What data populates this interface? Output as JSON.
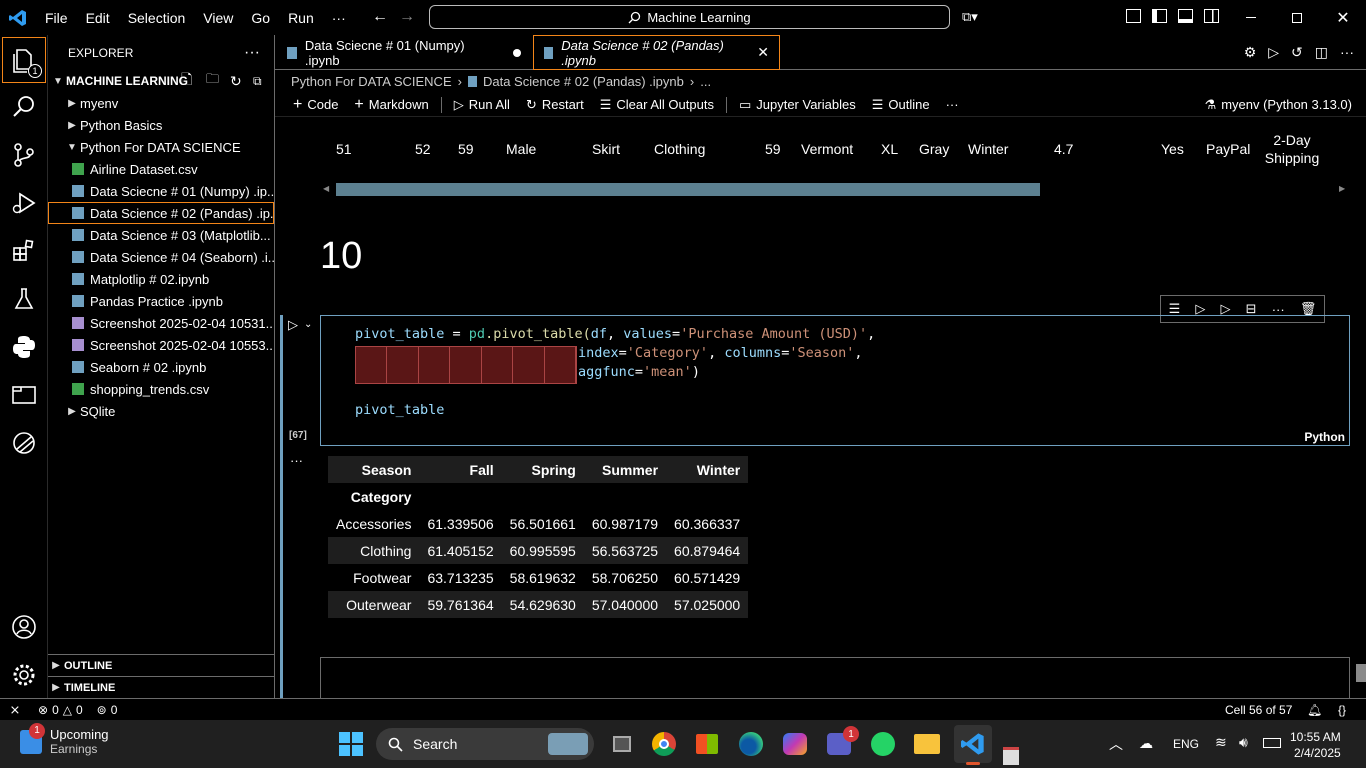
{
  "titlebar": {
    "menu": [
      "File",
      "Edit",
      "Selection",
      "View",
      "Go",
      "Run",
      "···"
    ],
    "search_text": "Machine Learning"
  },
  "activity": {
    "explorer_badge": "1"
  },
  "explorer": {
    "title": "EXPLORER",
    "root": "MACHINE LEARNING",
    "items": [
      {
        "label": "myenv",
        "type": "folder",
        "indent": 1,
        "open": false
      },
      {
        "label": "Python Basics",
        "type": "folder",
        "indent": 1,
        "open": false
      },
      {
        "label": "Python For DATA SCIENCE",
        "type": "folder",
        "indent": 1,
        "open": true
      },
      {
        "label": "Airline Dataset.csv",
        "type": "csv",
        "indent": 2
      },
      {
        "label": "Data Sciecne # 01 (Numpy) .ip...",
        "type": "nb",
        "indent": 2
      },
      {
        "label": "Data Science # 02 (Pandas) .ip...",
        "type": "nb",
        "indent": 2,
        "selected": true
      },
      {
        "label": "Data Science # 03  (Matplotlib...",
        "type": "nb",
        "indent": 2
      },
      {
        "label": "Data Science # 04  (Seaborn) .i...",
        "type": "nb",
        "indent": 2
      },
      {
        "label": "Matplotlip # 02.ipynb",
        "type": "nb",
        "indent": 2
      },
      {
        "label": "Pandas Practice .ipynb",
        "type": "nb",
        "indent": 2
      },
      {
        "label": "Screenshot 2025-02-04 10531...",
        "type": "img",
        "indent": 2
      },
      {
        "label": "Screenshot 2025-02-04 10553...",
        "type": "img",
        "indent": 2
      },
      {
        "label": "Seaborn # 02 .ipynb",
        "type": "nb",
        "indent": 2
      },
      {
        "label": "shopping_trends.csv",
        "type": "csv",
        "indent": 2
      },
      {
        "label": "SQlite",
        "type": "folder",
        "indent": 1,
        "open": false
      }
    ],
    "outline": "OUTLINE",
    "timeline": "TIMELINE"
  },
  "tabs": [
    {
      "label": "Data Sciecne # 01 (Numpy) .ipynb",
      "dirty": true
    },
    {
      "label": "Data Science # 02 (Pandas) .ipynb",
      "active": true
    }
  ],
  "breadcrumb": [
    "Python For DATA SCIENCE",
    "Data Science # 02 (Pandas) .ipynb",
    "..."
  ],
  "toolbar": {
    "code": "Code",
    "markdown": "Markdown",
    "run_all": "Run All",
    "restart": "Restart",
    "clear": "Clear All Outputs",
    "variables": "Jupyter Variables",
    "outline": "Outline",
    "more": "···",
    "kernel": "myenv (Python 3.13.0)"
  },
  "prev_output_row": [
    "51",
    "52",
    "59",
    "Male",
    "Skirt",
    "Clothing",
    "59",
    "Vermont",
    "XL",
    "Gray",
    "Winter",
    "4.7",
    "Yes",
    "PayPal",
    "2-Day",
    "Shipping"
  ],
  "markdown_heading": "10",
  "cell": {
    "exec_count": "[67]",
    "language": "Python",
    "line1_a": "pivot_table",
    "line1_b": " = ",
    "line1_c": "pd",
    "line1_d": ".pivot_table(",
    "line1_e": "df",
    "line1_f": ", ",
    "line1_g": "values",
    "line1_h": "=",
    "line1_i": "'Purchase Amount (USD)'",
    "line1_j": ",",
    "line2_a": "index",
    "line2_b": "=",
    "line2_c": "'Category'",
    "line2_d": ", ",
    "line2_e": "columns",
    "line2_f": "=",
    "line2_g": "'Season'",
    "line2_h": ",",
    "line3_a": "aggfunc",
    "line3_b": "=",
    "line3_c": "'mean'",
    "line3_d": ")",
    "line4": "pivot_table"
  },
  "output_more": "···",
  "pivot": {
    "columns_label": "Season",
    "columns": [
      "Fall",
      "Spring",
      "Summer",
      "Winter"
    ],
    "index_label": "Category",
    "rows": [
      {
        "name": "Accessories",
        "values": [
          "61.339506",
          "56.501661",
          "60.987179",
          "60.366337"
        ]
      },
      {
        "name": "Clothing",
        "values": [
          "61.405152",
          "60.995595",
          "56.563725",
          "60.879464"
        ]
      },
      {
        "name": "Footwear",
        "values": [
          "63.713235",
          "58.619632",
          "58.706250",
          "60.571429"
        ]
      },
      {
        "name": "Outerwear",
        "values": [
          "59.761364",
          "54.629630",
          "57.040000",
          "57.025000"
        ]
      }
    ]
  },
  "status": {
    "errors": "0",
    "warnings": "0",
    "ports": "0",
    "cell": "Cell 56 of 57"
  },
  "taskbar": {
    "widget_badge": "1",
    "widget_title": "Upcoming",
    "widget_sub": "Earnings",
    "search": "Search",
    "teams_badge": "1",
    "lang": "ENG",
    "time": "10:55 AM",
    "date": "2/4/2025"
  }
}
